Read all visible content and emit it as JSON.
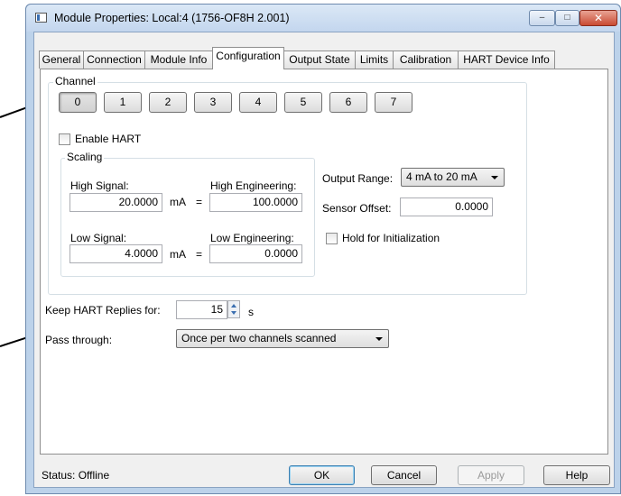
{
  "window": {
    "title": "Module Properties: Local:4 (1756-OF8H 2.001)",
    "caption_minimize": "–",
    "caption_maximize": "□",
    "caption_close": "✕"
  },
  "tabs": [
    {
      "label": "General",
      "active": false
    },
    {
      "label": "Connection",
      "active": false
    },
    {
      "label": "Module Info",
      "active": false
    },
    {
      "label": "Configuration",
      "active": true
    },
    {
      "label": "Output State",
      "active": false
    },
    {
      "label": "Limits",
      "active": false
    },
    {
      "label": "Calibration",
      "active": false
    },
    {
      "label": "HART Device Info",
      "active": false
    }
  ],
  "channel": {
    "group_label": "Channel",
    "buttons": [
      "0",
      "1",
      "2",
      "3",
      "4",
      "5",
      "6",
      "7"
    ],
    "selected": "0",
    "enable_hart_label": "Enable HART",
    "enable_hart_checked": false
  },
  "scaling": {
    "group_label": "Scaling",
    "high_signal_label": "High Signal:",
    "high_signal_value": "20.0000",
    "high_signal_unit": "mA",
    "high_equals": "=",
    "high_eng_label": "High Engineering:",
    "high_eng_value": "100.0000",
    "low_signal_label": "Low Signal:",
    "low_signal_value": "4.0000",
    "low_signal_unit": "mA",
    "low_equals": "=",
    "low_eng_label": "Low Engineering:",
    "low_eng_value": "0.0000"
  },
  "output": {
    "range_label": "Output Range:",
    "range_value": "4 mA to 20 mA",
    "sensor_offset_label": "Sensor Offset:",
    "sensor_offset_value": "0.0000",
    "hold_label": "Hold for Initialization",
    "hold_checked": false
  },
  "hart": {
    "keep_replies_label": "Keep HART Replies for:",
    "keep_replies_value": "15",
    "keep_replies_unit": "s",
    "pass_through_label": "Pass through:",
    "pass_through_value": "Once per two channels scanned"
  },
  "footer": {
    "status": "Status:  Offline",
    "ok": "OK",
    "cancel": "Cancel",
    "apply": "Apply",
    "help": "Help"
  }
}
